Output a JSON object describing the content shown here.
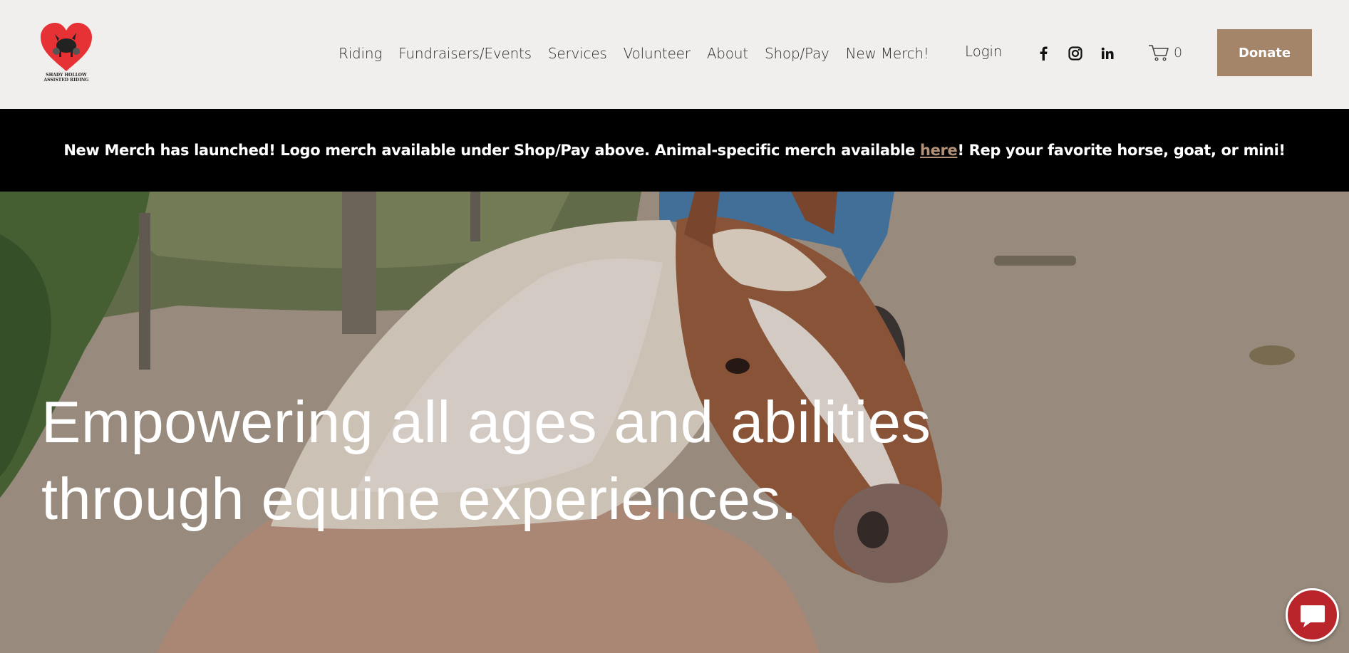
{
  "header": {
    "logo_lines": [
      "SHADY HOLLOW",
      "ASSISTED RIDING"
    ],
    "nav": [
      "Riding",
      "Fundraisers/Events",
      "Services",
      "Volunteer",
      "About",
      "Shop/Pay",
      "New Merch!"
    ],
    "login": "Login",
    "social_icons": [
      "facebook-icon",
      "instagram-icon",
      "linkedin-icon"
    ],
    "cart_count": "0",
    "donate": "Donate",
    "brand_color": "#a58569"
  },
  "announcement": {
    "before_link": "New Merch has launched! Logo merch available under Shop/Pay above. Animal-specific merch available ",
    "link": "here",
    "after_link": "! Rep your favorite horse, goat, or mini!",
    "link_color": "#b39076"
  },
  "hero": {
    "title_line1": "Empowering all ages and abilities",
    "title_line2": "through equine experiences."
  },
  "chat": {
    "icon": "chat-bubble-icon",
    "color": "#b9252b"
  }
}
